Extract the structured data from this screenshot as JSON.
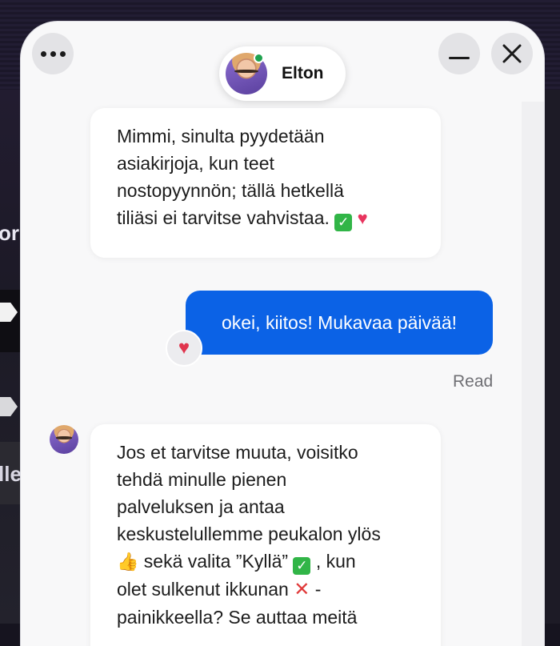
{
  "background": {
    "fragment_1": "ori",
    "fragment_2": "lle"
  },
  "header": {
    "agent_name": "Elton",
    "status": "online",
    "menu_icon": "more-horizontal-icon",
    "minimize_icon": "minimize-icon",
    "close_icon": "close-icon"
  },
  "messages": {
    "msg1": {
      "line1": "Mimmi, sinulta pyydetään",
      "line2": "asiakirjoja, kun teet",
      "line3": "nostopyynnön; tällä hetkellä",
      "line4": "tiliäsi ei tarvitse vahvistaa."
    },
    "msg2": {
      "text": "okei, kiitos! Mukavaa päivää!",
      "reaction": "heart",
      "status": "Read"
    },
    "msg3": {
      "line1": "Jos et tarvitse muuta, voisitko",
      "line2": "tehdä minulle pienen",
      "line3": "palveluksen ja antaa",
      "line4": "keskustelullemme peukalon ylös",
      "line5_b": " sekä valita ”Kyllä”",
      "line5_c": ", kun",
      "line6_a": "olet sulkenut ikkunan ",
      "line6_b": " -",
      "line7": "painikkeella? Se auttaa meitä"
    }
  },
  "colors": {
    "outgoing_bubble": "#0b62e6",
    "online_dot": "#1fa24f",
    "widget_bg": "#f8f8f9"
  }
}
